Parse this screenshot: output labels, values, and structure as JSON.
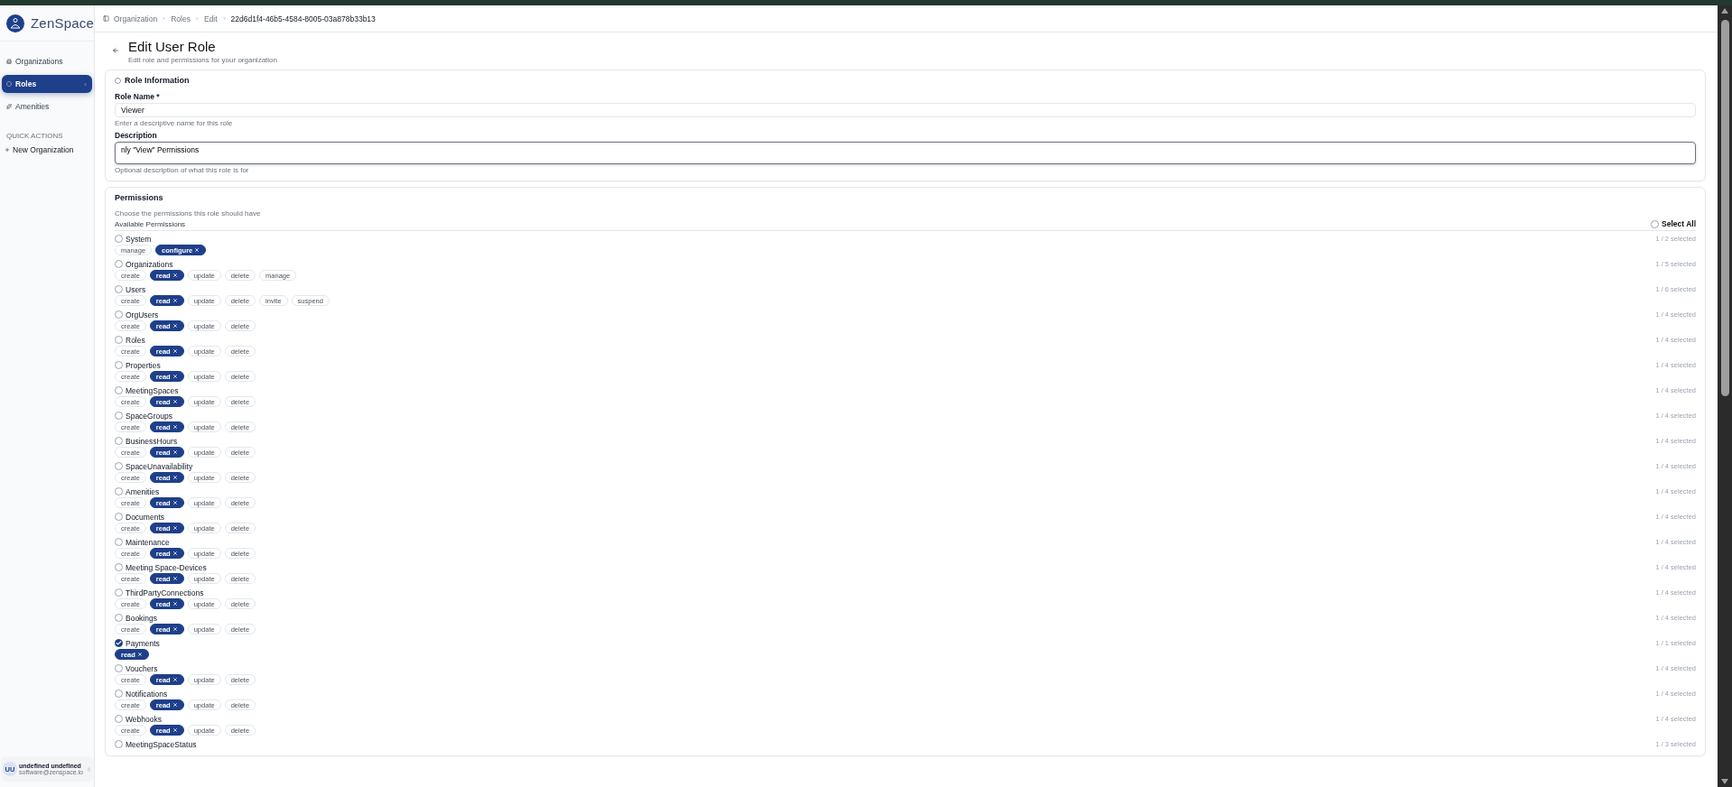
{
  "brand": "ZenSpace",
  "sidebar": {
    "items": [
      {
        "label": "Organizations",
        "selected": false
      },
      {
        "label": "Roles",
        "selected": true
      },
      {
        "label": "Amenities",
        "selected": false
      }
    ],
    "quick_actions_title": "QUICK ACTIONS",
    "quick_actions": [
      {
        "label": "New Organization"
      }
    ]
  },
  "user": {
    "initials": "UU",
    "name": "undefined undefined",
    "email": "software@zenspace.io"
  },
  "breadcrumb": [
    "Organization",
    "Roles",
    "Edit",
    "22d6d1f4-46b5-4584-8005-03a878b33b13"
  ],
  "page": {
    "title": "Edit User Role",
    "subtitle": "Edit role and permissions for your organization"
  },
  "role_information": {
    "title": "Role Information",
    "name_label": "Role Name *",
    "name_value": "Viewer",
    "name_hint": "Enter a descriptive name for this role",
    "description_label": "Description",
    "description_value": "nly \"View\" Permissions",
    "description_hint": "Optional description of what this role is for"
  },
  "permissions": {
    "title": "Permissions",
    "intro": "Choose the permissions this role should have",
    "available_label": "Available Permissions",
    "select_all": {
      "label": "Select All",
      "checked": false
    },
    "groups": [
      {
        "name": "System",
        "checked": false,
        "count": "1 / 2 selected",
        "actions": [
          {
            "label": "manage",
            "selected": false
          },
          {
            "label": "configure",
            "selected": true
          }
        ]
      },
      {
        "name": "Organizations",
        "checked": false,
        "count": "1 / 5 selected",
        "actions": [
          {
            "label": "create",
            "selected": false
          },
          {
            "label": "read",
            "selected": true
          },
          {
            "label": "update",
            "selected": false
          },
          {
            "label": "delete",
            "selected": false
          },
          {
            "label": "manage",
            "selected": false
          }
        ]
      },
      {
        "name": "Users",
        "checked": false,
        "count": "1 / 6 selected",
        "actions": [
          {
            "label": "create",
            "selected": false
          },
          {
            "label": "read",
            "selected": true
          },
          {
            "label": "update",
            "selected": false
          },
          {
            "label": "delete",
            "selected": false
          },
          {
            "label": "invite",
            "selected": false
          },
          {
            "label": "suspend",
            "selected": false
          }
        ]
      },
      {
        "name": "OrgUsers",
        "checked": false,
        "count": "1 / 4 selected",
        "actions": [
          {
            "label": "create",
            "selected": false
          },
          {
            "label": "read",
            "selected": true
          },
          {
            "label": "update",
            "selected": false
          },
          {
            "label": "delete",
            "selected": false
          }
        ]
      },
      {
        "name": "Roles",
        "checked": false,
        "count": "1 / 4 selected",
        "actions": [
          {
            "label": "create",
            "selected": false
          },
          {
            "label": "read",
            "selected": true
          },
          {
            "label": "update",
            "selected": false
          },
          {
            "label": "delete",
            "selected": false
          }
        ]
      },
      {
        "name": "Properties",
        "checked": false,
        "count": "1 / 4 selected",
        "actions": [
          {
            "label": "create",
            "selected": false
          },
          {
            "label": "read",
            "selected": true
          },
          {
            "label": "update",
            "selected": false
          },
          {
            "label": "delete",
            "selected": false
          }
        ]
      },
      {
        "name": "MeetingSpaces",
        "checked": false,
        "count": "1 / 4 selected",
        "actions": [
          {
            "label": "create",
            "selected": false
          },
          {
            "label": "read",
            "selected": true
          },
          {
            "label": "update",
            "selected": false
          },
          {
            "label": "delete",
            "selected": false
          }
        ]
      },
      {
        "name": "SpaceGroups",
        "checked": false,
        "count": "1 / 4 selected",
        "actions": [
          {
            "label": "create",
            "selected": false
          },
          {
            "label": "read",
            "selected": true
          },
          {
            "label": "update",
            "selected": false
          },
          {
            "label": "delete",
            "selected": false
          }
        ]
      },
      {
        "name": "BusinessHours",
        "checked": false,
        "count": "1 / 4 selected",
        "actions": [
          {
            "label": "create",
            "selected": false
          },
          {
            "label": "read",
            "selected": true
          },
          {
            "label": "update",
            "selected": false
          },
          {
            "label": "delete",
            "selected": false
          }
        ]
      },
      {
        "name": "SpaceUnavailability",
        "checked": false,
        "count": "1 / 4 selected",
        "actions": [
          {
            "label": "create",
            "selected": false
          },
          {
            "label": "read",
            "selected": true
          },
          {
            "label": "update",
            "selected": false
          },
          {
            "label": "delete",
            "selected": false
          }
        ]
      },
      {
        "name": "Amenities",
        "checked": false,
        "count": "1 / 4 selected",
        "actions": [
          {
            "label": "create",
            "selected": false
          },
          {
            "label": "read",
            "selected": true
          },
          {
            "label": "update",
            "selected": false
          },
          {
            "label": "delete",
            "selected": false
          }
        ]
      },
      {
        "name": "Documents",
        "checked": false,
        "count": "1 / 4 selected",
        "actions": [
          {
            "label": "create",
            "selected": false
          },
          {
            "label": "read",
            "selected": true
          },
          {
            "label": "update",
            "selected": false
          },
          {
            "label": "delete",
            "selected": false
          }
        ]
      },
      {
        "name": "Maintenance",
        "checked": false,
        "count": "1 / 4 selected",
        "actions": [
          {
            "label": "create",
            "selected": false
          },
          {
            "label": "read",
            "selected": true
          },
          {
            "label": "update",
            "selected": false
          },
          {
            "label": "delete",
            "selected": false
          }
        ]
      },
      {
        "name": "Meeting Space-Devices",
        "checked": false,
        "count": "1 / 4 selected",
        "actions": [
          {
            "label": "create",
            "selected": false
          },
          {
            "label": "read",
            "selected": true
          },
          {
            "label": "update",
            "selected": false
          },
          {
            "label": "delete",
            "selected": false
          }
        ]
      },
      {
        "name": "ThirdPartyConnections",
        "checked": false,
        "count": "1 / 4 selected",
        "actions": [
          {
            "label": "create",
            "selected": false
          },
          {
            "label": "read",
            "selected": true
          },
          {
            "label": "update",
            "selected": false
          },
          {
            "label": "delete",
            "selected": false
          }
        ]
      },
      {
        "name": "Bookings",
        "checked": false,
        "count": "1 / 4 selected",
        "actions": [
          {
            "label": "create",
            "selected": false
          },
          {
            "label": "read",
            "selected": true
          },
          {
            "label": "update",
            "selected": false
          },
          {
            "label": "delete",
            "selected": false
          }
        ]
      },
      {
        "name": "Payments",
        "checked": true,
        "count": "1 / 1 selected",
        "actions": [
          {
            "label": "read",
            "selected": true
          }
        ]
      },
      {
        "name": "Vouchers",
        "checked": false,
        "count": "1 / 4 selected",
        "actions": [
          {
            "label": "create",
            "selected": false
          },
          {
            "label": "read",
            "selected": true
          },
          {
            "label": "update",
            "selected": false
          },
          {
            "label": "delete",
            "selected": false
          }
        ]
      },
      {
        "name": "Notifications",
        "checked": false,
        "count": "1 / 4 selected",
        "actions": [
          {
            "label": "create",
            "selected": false
          },
          {
            "label": "read",
            "selected": true
          },
          {
            "label": "update",
            "selected": false
          },
          {
            "label": "delete",
            "selected": false
          }
        ]
      },
      {
        "name": "Webhooks",
        "checked": false,
        "count": "1 / 4 selected",
        "actions": [
          {
            "label": "create",
            "selected": false
          },
          {
            "label": "read",
            "selected": true
          },
          {
            "label": "update",
            "selected": false
          },
          {
            "label": "delete",
            "selected": false
          }
        ]
      },
      {
        "name": "MeetingSpaceStatus",
        "checked": false,
        "count": "1 / 3 selected"
      }
    ]
  }
}
